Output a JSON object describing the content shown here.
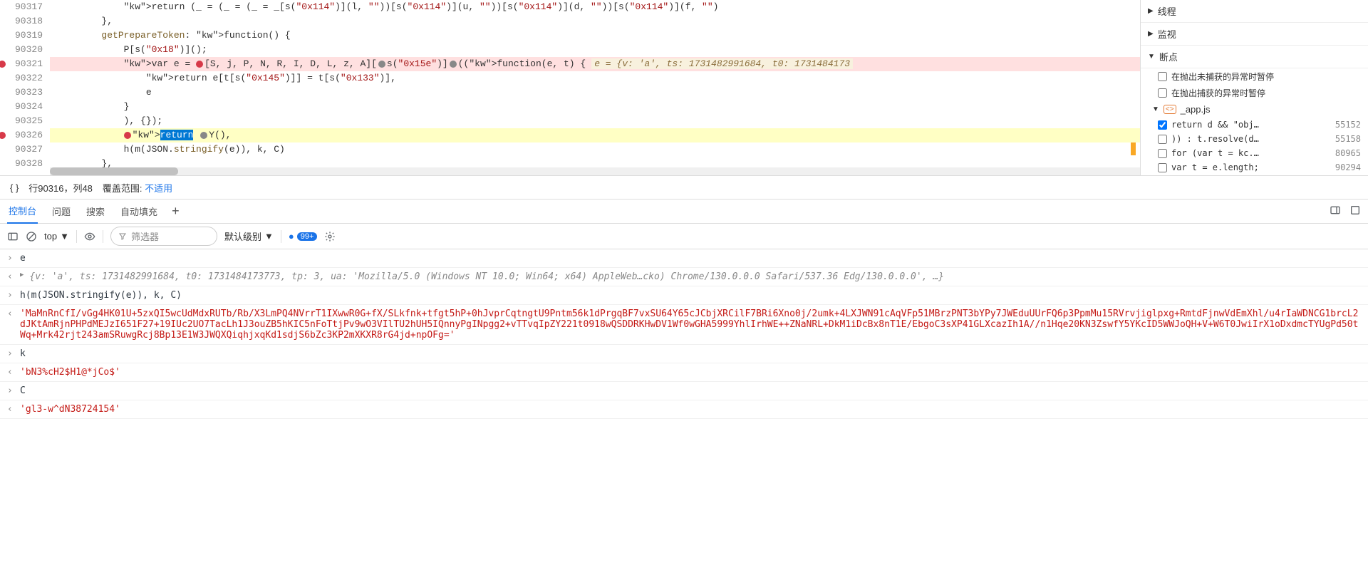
{
  "code": {
    "lines": [
      {
        "n": 90317,
        "text": "            return (_ = (_ = (_ = _[s(\"0x114\")](l, \"\"))[s(\"0x114\")](u, \"\"))[s(\"0x114\")](d, \"\"))[s(\"0x114\")](f, \"\")"
      },
      {
        "n": 90318,
        "text": "        },"
      },
      {
        "n": 90319,
        "text": "        getPrepareToken: function() {"
      },
      {
        "n": 90320,
        "text": "            P[s(\"0x18\")]();"
      },
      {
        "n": 90321,
        "bp": true,
        "hl": "red",
        "text": "            var e = ●[S, j, P, N, R, I, D, L, z, A][●s(\"0x15e\")]●((function(e, t) {",
        "hint": "e = {v: 'a', ts: 1731482991684, t0: 1731484173"
      },
      {
        "n": 90322,
        "text": "                return e[t[s(\"0x145\")]] = t[s(\"0x133\")],"
      },
      {
        "n": 90323,
        "text": "                e"
      },
      {
        "n": 90324,
        "text": "            }"
      },
      {
        "n": 90325,
        "text": "            ), {});"
      },
      {
        "n": 90326,
        "bp": true,
        "hl": "yellow",
        "text": "            ●return ●Y(),",
        "sel": "return"
      },
      {
        "n": 90327,
        "text": "            h(m(JSON.stringify(e)), k, C)"
      },
      {
        "n": 90328,
        "text": "        },"
      }
    ]
  },
  "status": {
    "cursor": "行90316，列48",
    "coverage_label": "覆盖范围:",
    "coverage_value": "不适用"
  },
  "side": {
    "threads": "线程",
    "watch": "监视",
    "breakpoints": "断点",
    "pause_uncaught": "在抛出未捕获的异常时暂停",
    "pause_caught": "在抛出捕获的异常时暂停",
    "file": "_app.js",
    "items": [
      {
        "checked": true,
        "code": "return d && \"obj…",
        "ln": "55152"
      },
      {
        "checked": false,
        "code": ")) : t.resolve(d…",
        "ln": "55158"
      },
      {
        "checked": false,
        "code": "for (var t = kc.…",
        "ln": "80965"
      },
      {
        "checked": false,
        "code": "var t = e.length;",
        "ln": "90294"
      }
    ]
  },
  "tabs": {
    "console": "控制台",
    "issues": "问题",
    "search": "搜索",
    "autofill": "自动填充"
  },
  "toolbar": {
    "top": "top",
    "filter_ph": "筛选器",
    "level": "默认级别",
    "count": "99+"
  },
  "console": {
    "r1": "e",
    "r2_prefix": "{",
    "r2": "v: 'a', ts: 1731482991684, t0: 1731484173773, tp: 3, ua: 'Mozilla/5.0 (Windows NT 10.0; Win64; x64) AppleWeb…cko) Chrome/130.0.0.0 Safari/537.36 Edg/130.0.0.0', …",
    "r2_suffix": "}",
    "r3": "h(m(JSON.stringify(e)), k, C)",
    "r4": "'MaMnRnCfI/vGg4HK01U+5zxQI5wcUdMdxRUTb/Rb/X3LmPQ4NVrrT1IXwwR0G+fX/SLkfnk+tfgt5hP+0hJvprCqtngtU9Pntm56k1dPrgqBF7vxSU64Y65cJCbjXRCilF7BRi6Xno0j/2umk+4LXJWN91cAqVFp51MBrzPNT3bYPy7JWEduUUrFQ6p3PpmMu15RVrvjiglpxg+RmtdFjnwVdEmXhl/u4rIaWDNCG1brcL2dJKtAmRjnPHPdMEJzI651F27+19IUc2UO7TacLh1J3ouZB5hKIC5nFoTtjPv9wO3VIlTU2hUH5IQnnyPgINpgg2+vTTvqIpZY221t0918wQSDDRKHwDV1Wf0wGHA5999YhlIrhWE++ZNaNRL+DkM1iDcBx8nT1E/EbgoC3sXP41GLXcazIh1A//n1Hqe20KN3ZswfY5YKcID5WWJoQH+V+W6T0JwiIrX1oDxdmcTYUgPd50tWq+Mrk42rjt243amSRuwgRcj8Bp13E1W3JWQXQiqhjxqKd1sdjS6bZc3KP2mXKXR8rG4jd+npOFg='",
    "r5": "k",
    "r6": "'bN3%cH2$H1@*jCo$'",
    "r7": "C",
    "r8": "'gl3-w^dN38724154'"
  }
}
